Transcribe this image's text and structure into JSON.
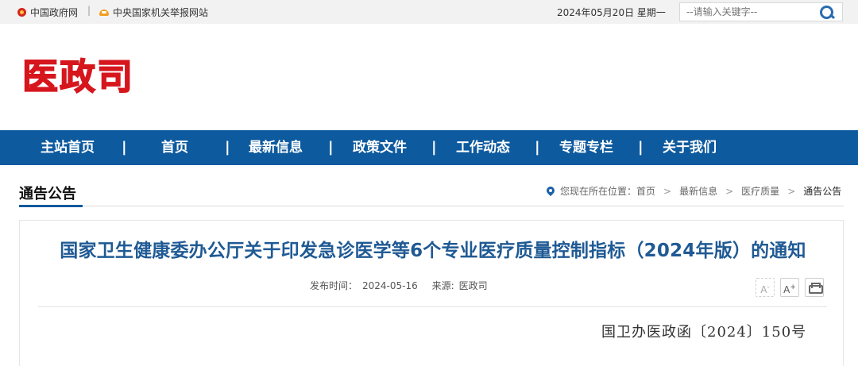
{
  "topbar": {
    "gov_link": "中国政府网",
    "separator": "|",
    "report_link": "中央国家机关举报网站",
    "date": "2024年05月20日 星期一",
    "search_placeholder": "--请输入关键字--"
  },
  "header": {
    "logo_text": "医政司"
  },
  "nav": {
    "items": [
      {
        "label": "主站首页"
      },
      {
        "label": "首页"
      },
      {
        "label": "最新信息"
      },
      {
        "label": "政策文件"
      },
      {
        "label": "工作动态"
      },
      {
        "label": "专题专栏"
      },
      {
        "label": "关于我们"
      }
    ],
    "separator": "|"
  },
  "section": {
    "title": "通告公告"
  },
  "breadcrumb": {
    "prefix": "您现在所在位置：",
    "items": [
      "首页",
      "最新信息",
      "医疗质量",
      "通告公告"
    ],
    "chevron": ">"
  },
  "article": {
    "title": "国家卫生健康委办公厅关于印发急诊医学等6个专业医疗质量控制指标（2024年版）的通知",
    "publish_label": "发布时间：",
    "publish_date": "2024-05-16",
    "source_label": "来源:",
    "source": "医政司",
    "doc_number": "国卫办医政函〔2024〕150号"
  },
  "tools": {
    "font_decrease": "A",
    "font_decrease_mark": "-",
    "font_increase": "A",
    "font_increase_mark": "+"
  },
  "colors": {
    "nav_bg": "#0d5a9e",
    "logo_red": "#d6161d",
    "title_blue": "#1f5a94"
  }
}
